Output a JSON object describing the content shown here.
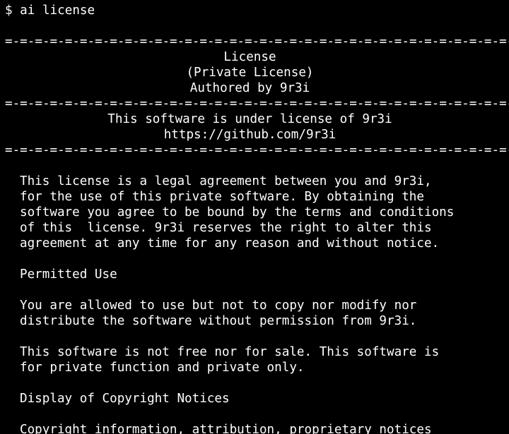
{
  "terminal": {
    "prompt": "$ ai license",
    "separator": "=-=-=-=-=-=-=-=-=-=-=-=-=-=-=-=-=-=-=-=-=-=-=-=-=-=-=-=-=-=-=-=-=-=-=-=-=",
    "header": {
      "title": "License",
      "subtitle": "(Private License)",
      "author": "Authored by 9r3i"
    },
    "notice": {
      "line1": "This software is under license of 9r3i",
      "line2": "https://github.com/9r3i"
    },
    "body": {
      "para1": [
        "This license is a legal agreement between you and 9r3i,",
        "for the use of this private software. By obtaining the",
        "software you agree to be bound by the terms and conditions",
        "of this  license. 9r3i reserves the right to alter this",
        "agreement at any time for any reason and without notice."
      ],
      "permitted_heading": "Permitted Use",
      "para2": [
        "You are allowed to use but not to copy nor modify nor",
        "distribute the software without permission from 9r3i."
      ],
      "para3": [
        "This software is not free nor for sale. This software is",
        "for private function and private only."
      ],
      "copyright_heading": "Display of Copyright Notices",
      "para4_partial": "Copyright information, attribution, proprietary notices"
    },
    "colors": {
      "background": "#000000",
      "foreground": "#ffffff"
    }
  }
}
